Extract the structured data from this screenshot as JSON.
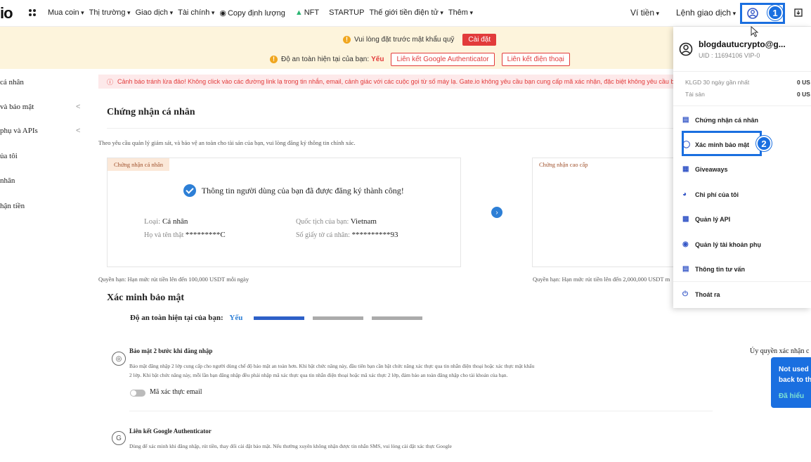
{
  "topnav": {
    "logo": "io",
    "items": [
      "Mua coin",
      "Thị trường",
      "Giao dịch",
      "Tài chính",
      "Copy định lượng",
      "NFT",
      "STARTUP",
      "Thế giới tiền điện tử",
      "Thêm"
    ],
    "wallet": "Ví tiền",
    "orders": "Lệnh giao dịch"
  },
  "warning": {
    "password_msg": "Vui lòng đặt trước mật khẩu quỹ",
    "setup_btn": "Cài đặt",
    "security_prefix": "Độ an toàn hiện tại của bạn:",
    "security_level": "Yếu",
    "link_ga_btn": "Liên kết Google Authenticator",
    "link_phone_btn": "Liên kết điện thoại"
  },
  "sidebar": {
    "items": [
      {
        "label": "cá nhân"
      },
      {
        "label": "và bảo mật"
      },
      {
        "label": "phụ và APIs"
      },
      {
        "label": "ủa tôi"
      },
      {
        "label": "nhân"
      },
      {
        "label": "hận tiền"
      }
    ]
  },
  "main": {
    "alert": "Cảnh báo tránh lừa đảo! Không click vào các đường link lạ trong tin nhắn, email, cảnh giác với các cuộc gọi từ số máy lạ. Gate.io không yêu cầu bạn cung cấp mã xác nhận, đặc biệt không yêu cầu bạn c",
    "kyc_title": "Chứng nhận cá nhân",
    "kyc_sub": "Theo yêu cầu quản lý giám sát, và bảo vệ an toàn cho tài sản của bạn, vui lòng đăng ký thông tin chính xác.",
    "card1": {
      "tag": "Chứng nhận cá nhân",
      "success": "Thông tin người dùng của bạn đã được đăng ký thành công!",
      "type_label": "Loại:",
      "type_value": "Cá nhân",
      "name_label": "Họ và tên thật",
      "name_value": "*********C",
      "nat_label": "Quốc tịch của bạn:",
      "nat_value": "Vietnam",
      "id_label": "Số giấy tờ cá nhân:",
      "id_value": "**********93",
      "limit": "Quyền hạn: Hạn mức rút tiền lên đến 100,000 USDT mỗi ngày"
    },
    "card2": {
      "tag": "Chứng nhận cao cấp",
      "limit": "Quyền hạn: Hạn mức rút tiền lên đến 2,000,000 USDT m"
    },
    "sec_title": "Xác minh bảo mật",
    "sec_level_label": "Độ an toàn hiện tại của bạn:",
    "sec_level_value": "Yếu",
    "security_progress": 0.33,
    "twofa": {
      "title": "Bảo mật 2 bước khi đăng nhập",
      "desc1": "Bảo mật đăng nhập 2 lớp cung cấp cho người dùng chế độ bảo mật an toàn hơn. Khi bật chức năng này, đầu tiên bạn cần bật chức năng xác thực qua tin nhắn điện thoại hoặc xác thực mật khẩu",
      "desc2": "2 lớp. Khi bật chức năng này, mỗi lần bạn đăng nhập đều phải nhập mã xác thực qua tin nhắn điện thoại hoặc mã xác thực 2 lớp, đảm bảo an toàn đăng nhập cho tài khoản của bạn.",
      "toggle_label": "Mã xác thực email",
      "right_label": "Ủy quyền xác nhận c"
    },
    "ga": {
      "title": "Liên kết Google Authenticator",
      "desc": "Dùng để xác minh khi đăng nhập, rút tiền, thay đổi cài đặt bảo mật. Nếu thường xuyên không nhận được tin nhắn SMS, vui lòng cài đặt xác thực Google"
    }
  },
  "dropdown": {
    "email": "blogdautucrypto@g...",
    "uid": "UID : 11694106   VIP-0",
    "stat1_label": "KLGD 30 ngày gần nhất",
    "stat1_value": "0 US",
    "stat2_label": "Tài sản",
    "stat2_value": "0 US",
    "items": [
      {
        "label": "Chứng nhận cá nhân",
        "icon": "id-card-icon"
      },
      {
        "label": "Xác minh bảo mật",
        "icon": "shield-icon"
      },
      {
        "label": "Giveaways",
        "icon": "gift-icon"
      },
      {
        "label": "Chi phí của tôi",
        "icon": "coin-icon"
      },
      {
        "label": "Quản lý API",
        "icon": "api-icon"
      },
      {
        "label": "Quản lý tài khoản phụ",
        "icon": "subaccount-icon"
      },
      {
        "label": "Thông tin tư vấn",
        "icon": "news-icon"
      },
      {
        "label": "Thoát ra",
        "icon": "power-icon"
      }
    ]
  },
  "annotations": {
    "step1": "1",
    "step2": "2"
  },
  "popup": {
    "line1": "Not used",
    "line2": "back to th",
    "action": "Đã hiểu"
  },
  "colors": {
    "accent": "#1a6fe0",
    "danger": "#e23b3b",
    "brand_blue": "#2d7fd6"
  }
}
